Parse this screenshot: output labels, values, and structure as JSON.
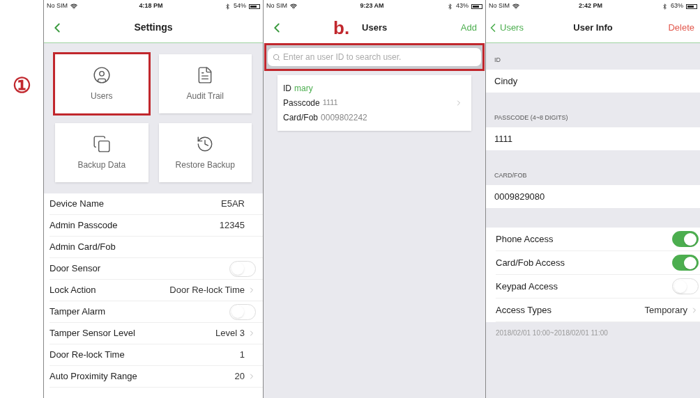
{
  "step_marker": "①",
  "settings_screen": {
    "status_bar": {
      "carrier": "No SIM",
      "time": "4:18 PM",
      "battery": "54%"
    },
    "title": "Settings",
    "tiles": [
      {
        "kind": "user",
        "label": "Users",
        "highlighted": true
      },
      {
        "kind": "document",
        "label": "Audit Trail",
        "highlighted": false
      },
      {
        "kind": "copies",
        "label": "Backup Data",
        "highlighted": false
      },
      {
        "kind": "history",
        "label": "Restore Backup",
        "highlighted": false
      }
    ],
    "rows": [
      {
        "kind": "value",
        "label": "Device Name",
        "value": "E5AR"
      },
      {
        "kind": "value",
        "label": "Admin Passcode",
        "value": "12345"
      },
      {
        "kind": "value",
        "label": "Admin Card/Fob"
      },
      {
        "kind": "toggle",
        "label": "Door Sensor",
        "on": false
      },
      {
        "kind": "link",
        "label": "Lock Action",
        "value": "Door Re-lock Time"
      },
      {
        "kind": "toggle",
        "label": "Tamper Alarm",
        "on": false
      },
      {
        "kind": "link",
        "label": "Tamper Sensor Level",
        "value": "Level 3"
      },
      {
        "kind": "value",
        "label": "Door Re-lock Time",
        "value": "1"
      },
      {
        "kind": "link",
        "label": "Auto Proximity Range",
        "value": "20"
      }
    ]
  },
  "users_screen": {
    "status_bar": {
      "carrier": "No SIM",
      "time": "9:23 AM",
      "battery": "43%"
    },
    "step_marker": "b.",
    "title": "Users",
    "add_button": "Add",
    "search": {
      "placeholder": "Enter an user ID to search user.",
      "highlighted": true
    },
    "users": [
      {
        "id_label": "ID",
        "id": "mary",
        "passcode_label": "Passcode",
        "passcode": "1111",
        "card_label": "Card/Fob",
        "card": "0009802242"
      }
    ]
  },
  "user_info_screen": {
    "status_bar": {
      "carrier": "No SIM",
      "time": "2:42 PM",
      "battery": "63%"
    },
    "back_button": "Users",
    "title": "User Info",
    "delete_button": "Delete",
    "fields": [
      {
        "header": "ID",
        "value": "Cindy"
      },
      {
        "header": "PASSCODE (4~8 DIGITS)",
        "value": "1111"
      },
      {
        "header": "CARD/FOB",
        "value": "0009829080"
      }
    ],
    "rows": [
      {
        "kind": "toggle",
        "label": "Phone Access",
        "on": true
      },
      {
        "kind": "toggle",
        "label": "Card/Fob Access",
        "on": true
      },
      {
        "kind": "toggle",
        "label": "Keypad Access",
        "on": false
      },
      {
        "kind": "link",
        "label": "Access Types",
        "value": "Temporary"
      }
    ],
    "footnote": "2018/02/01 10:00~2018/02/01 11:00"
  }
}
